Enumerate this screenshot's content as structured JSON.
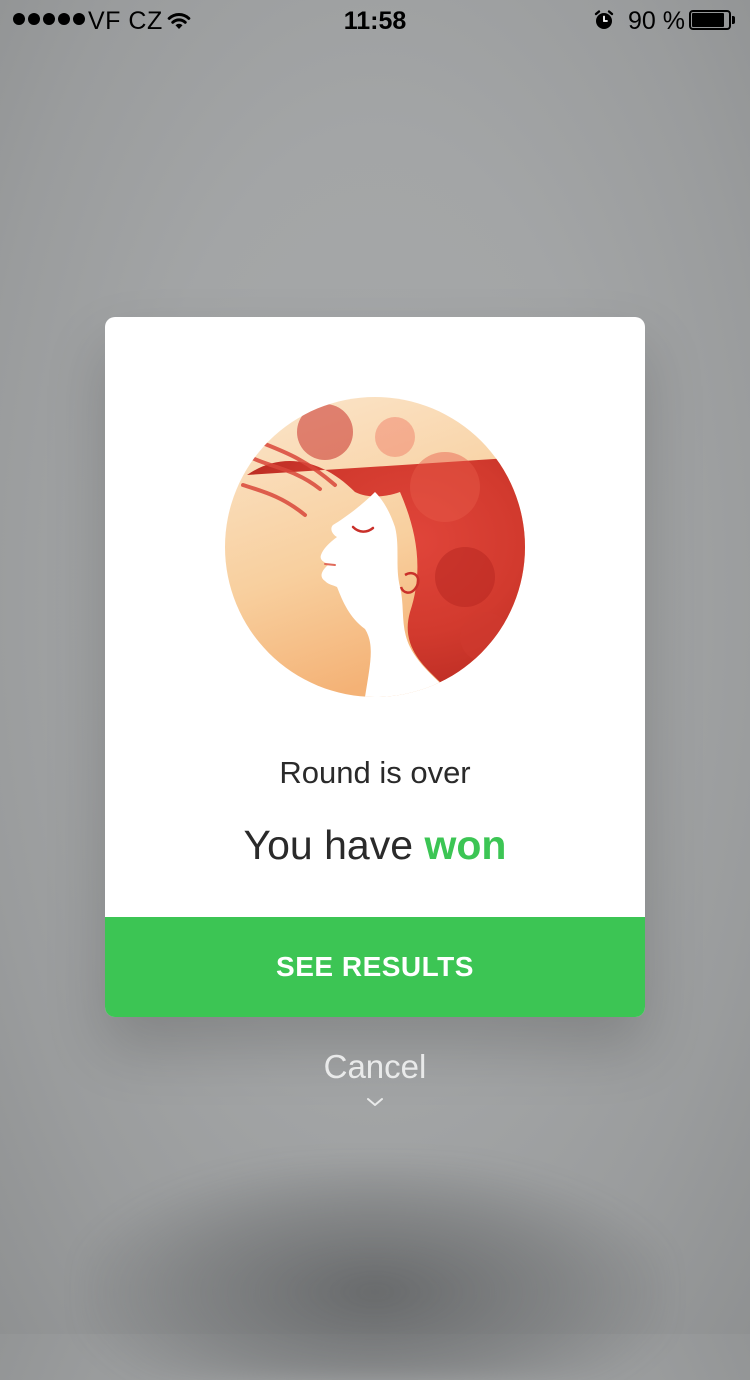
{
  "status_bar": {
    "carrier": "VF CZ",
    "time": "11:58",
    "battery_percent": "90 %",
    "battery_level": 0.9,
    "signal_bars": 5,
    "icons": [
      "signal-dots-icon",
      "wifi-icon",
      "alarm-icon",
      "battery-icon"
    ]
  },
  "dialog": {
    "subtitle": "Round is over",
    "title_prefix": "You have",
    "title_result": "won",
    "primary_button": "SEE RESULTS",
    "illustration": "woman-profile-red-hair-illustration"
  },
  "cancel": {
    "label": "Cancel",
    "icon": "chevron-down-icon"
  },
  "colors": {
    "accent_green": "#3cc554",
    "dialog_background": "#ffffff",
    "overlay_gray": "#a3a5a6"
  }
}
